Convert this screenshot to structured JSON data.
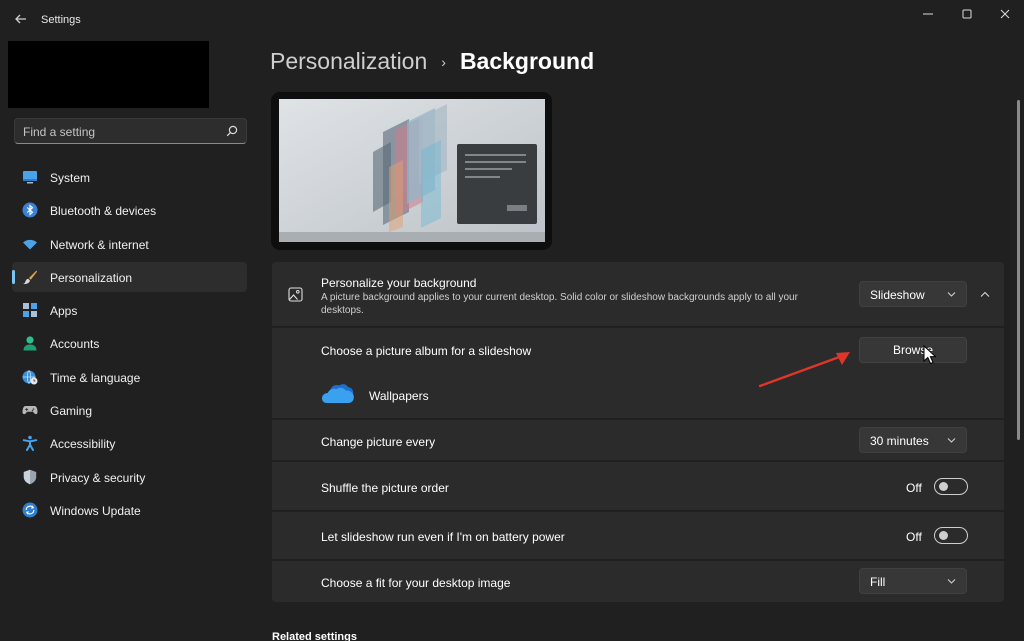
{
  "window": {
    "title": "Settings",
    "controls": [
      "minimize-icon",
      "maximize-icon",
      "close-icon"
    ]
  },
  "search": {
    "placeholder": "Find a setting",
    "icon": "search-icon"
  },
  "sidebar": {
    "items": [
      {
        "label": "System",
        "icon": "system-icon",
        "active": false
      },
      {
        "label": "Bluetooth & devices",
        "icon": "bluetooth-icon",
        "active": false
      },
      {
        "label": "Network & internet",
        "icon": "wifi-icon",
        "active": false
      },
      {
        "label": "Personalization",
        "icon": "paintbrush-icon",
        "active": true
      },
      {
        "label": "Apps",
        "icon": "apps-icon",
        "active": false
      },
      {
        "label": "Accounts",
        "icon": "account-icon",
        "active": false
      },
      {
        "label": "Time & language",
        "icon": "globe-clock-icon",
        "active": false
      },
      {
        "label": "Gaming",
        "icon": "gamepad-icon",
        "active": false
      },
      {
        "label": "Accessibility",
        "icon": "accessibility-icon",
        "active": false
      },
      {
        "label": "Privacy & security",
        "icon": "shield-icon",
        "active": false
      },
      {
        "label": "Windows Update",
        "icon": "update-icon",
        "active": false
      }
    ]
  },
  "breadcrumb": {
    "parent": "Personalization",
    "separator": "›",
    "current": "Background"
  },
  "background_settings": {
    "header": {
      "title": "Personalize your background",
      "description": "A picture background applies to your current desktop. Solid color or slideshow backgrounds apply to all your desktops.",
      "dropdown_value": "Slideshow",
      "icon": "picture-icon"
    },
    "album": {
      "label": "Choose a picture album for a slideshow",
      "button": "Browse",
      "folder_name": "Wallpapers",
      "folder_icon": "onedrive-cloud-icon"
    },
    "change_every": {
      "label": "Change picture every",
      "value": "30 minutes"
    },
    "shuffle": {
      "label": "Shuffle the picture order",
      "state": "Off"
    },
    "battery": {
      "label": "Let slideshow run even if I'm on battery power",
      "state": "Off"
    },
    "fit": {
      "label": "Choose a fit for your desktop image",
      "value": "Fill"
    }
  },
  "related": {
    "heading": "Related settings"
  },
  "colors": {
    "background": "#202020",
    "card": "#2b2b2b",
    "accent": "#7cc4f2",
    "annotation_arrow": "#e0352b"
  }
}
